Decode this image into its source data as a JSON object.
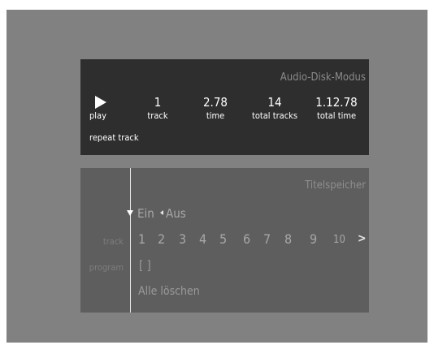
{
  "status": {
    "mode_title": "Audio-Disk-Modus",
    "play_label": "play",
    "track_value": "1",
    "track_label": "track",
    "time_value": "2.78",
    "time_label": "time",
    "total_tracks_value": "14",
    "total_tracks_label": "total tracks",
    "total_time_value": "1.12.78",
    "total_time_label": "total time",
    "repeat_label": "repeat track"
  },
  "program": {
    "title": "Titelspeicher",
    "on_label": "Ein",
    "off_label": "Aus",
    "track_label": "track",
    "program_label": "program",
    "tracks": [
      "1",
      "2",
      "3",
      "4",
      "5",
      "6",
      "7",
      "8",
      "9",
      "10"
    ],
    "program_value": "[ ]",
    "clear_label": "Alle löschen"
  }
}
